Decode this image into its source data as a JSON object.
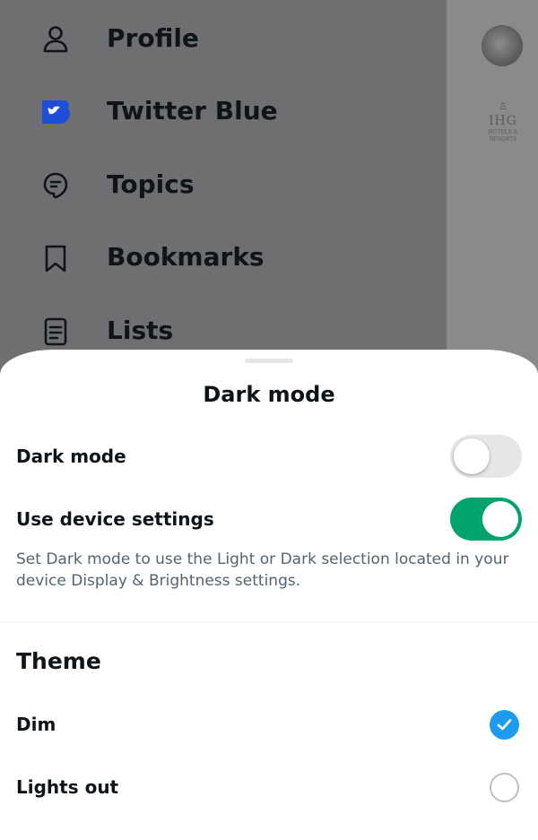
{
  "drawer": {
    "items": [
      {
        "label": "Profile",
        "icon": "person-icon"
      },
      {
        "label": "Twitter Blue",
        "icon": "twitter-blue-icon"
      },
      {
        "label": "Topics",
        "icon": "topics-icon"
      },
      {
        "label": "Bookmarks",
        "icon": "bookmark-icon"
      },
      {
        "label": "Lists",
        "icon": "lists-icon"
      }
    ],
    "side_logo": {
      "mark": "♙",
      "text": "IHG",
      "small": "HOTELS & RESORTS"
    }
  },
  "sheet": {
    "title": "Dark mode",
    "dark_mode": {
      "label": "Dark mode",
      "on": false
    },
    "device_settings": {
      "label": "Use device settings",
      "on": true
    },
    "helper_text": "Set Dark mode to use the Light or Dark selection located in your device Display & Brightness settings.",
    "theme": {
      "title": "Theme",
      "options": [
        {
          "label": "Dim",
          "selected": true
        },
        {
          "label": "Lights out",
          "selected": false
        }
      ]
    }
  },
  "colors": {
    "toggle_on": "#00a36c",
    "toggle_off": "#e6e6e6",
    "radio_selected": "#1d9bf0",
    "text_primary": "#0f1419",
    "text_secondary": "#536471",
    "twitter_blue": "#1d4ed8"
  }
}
